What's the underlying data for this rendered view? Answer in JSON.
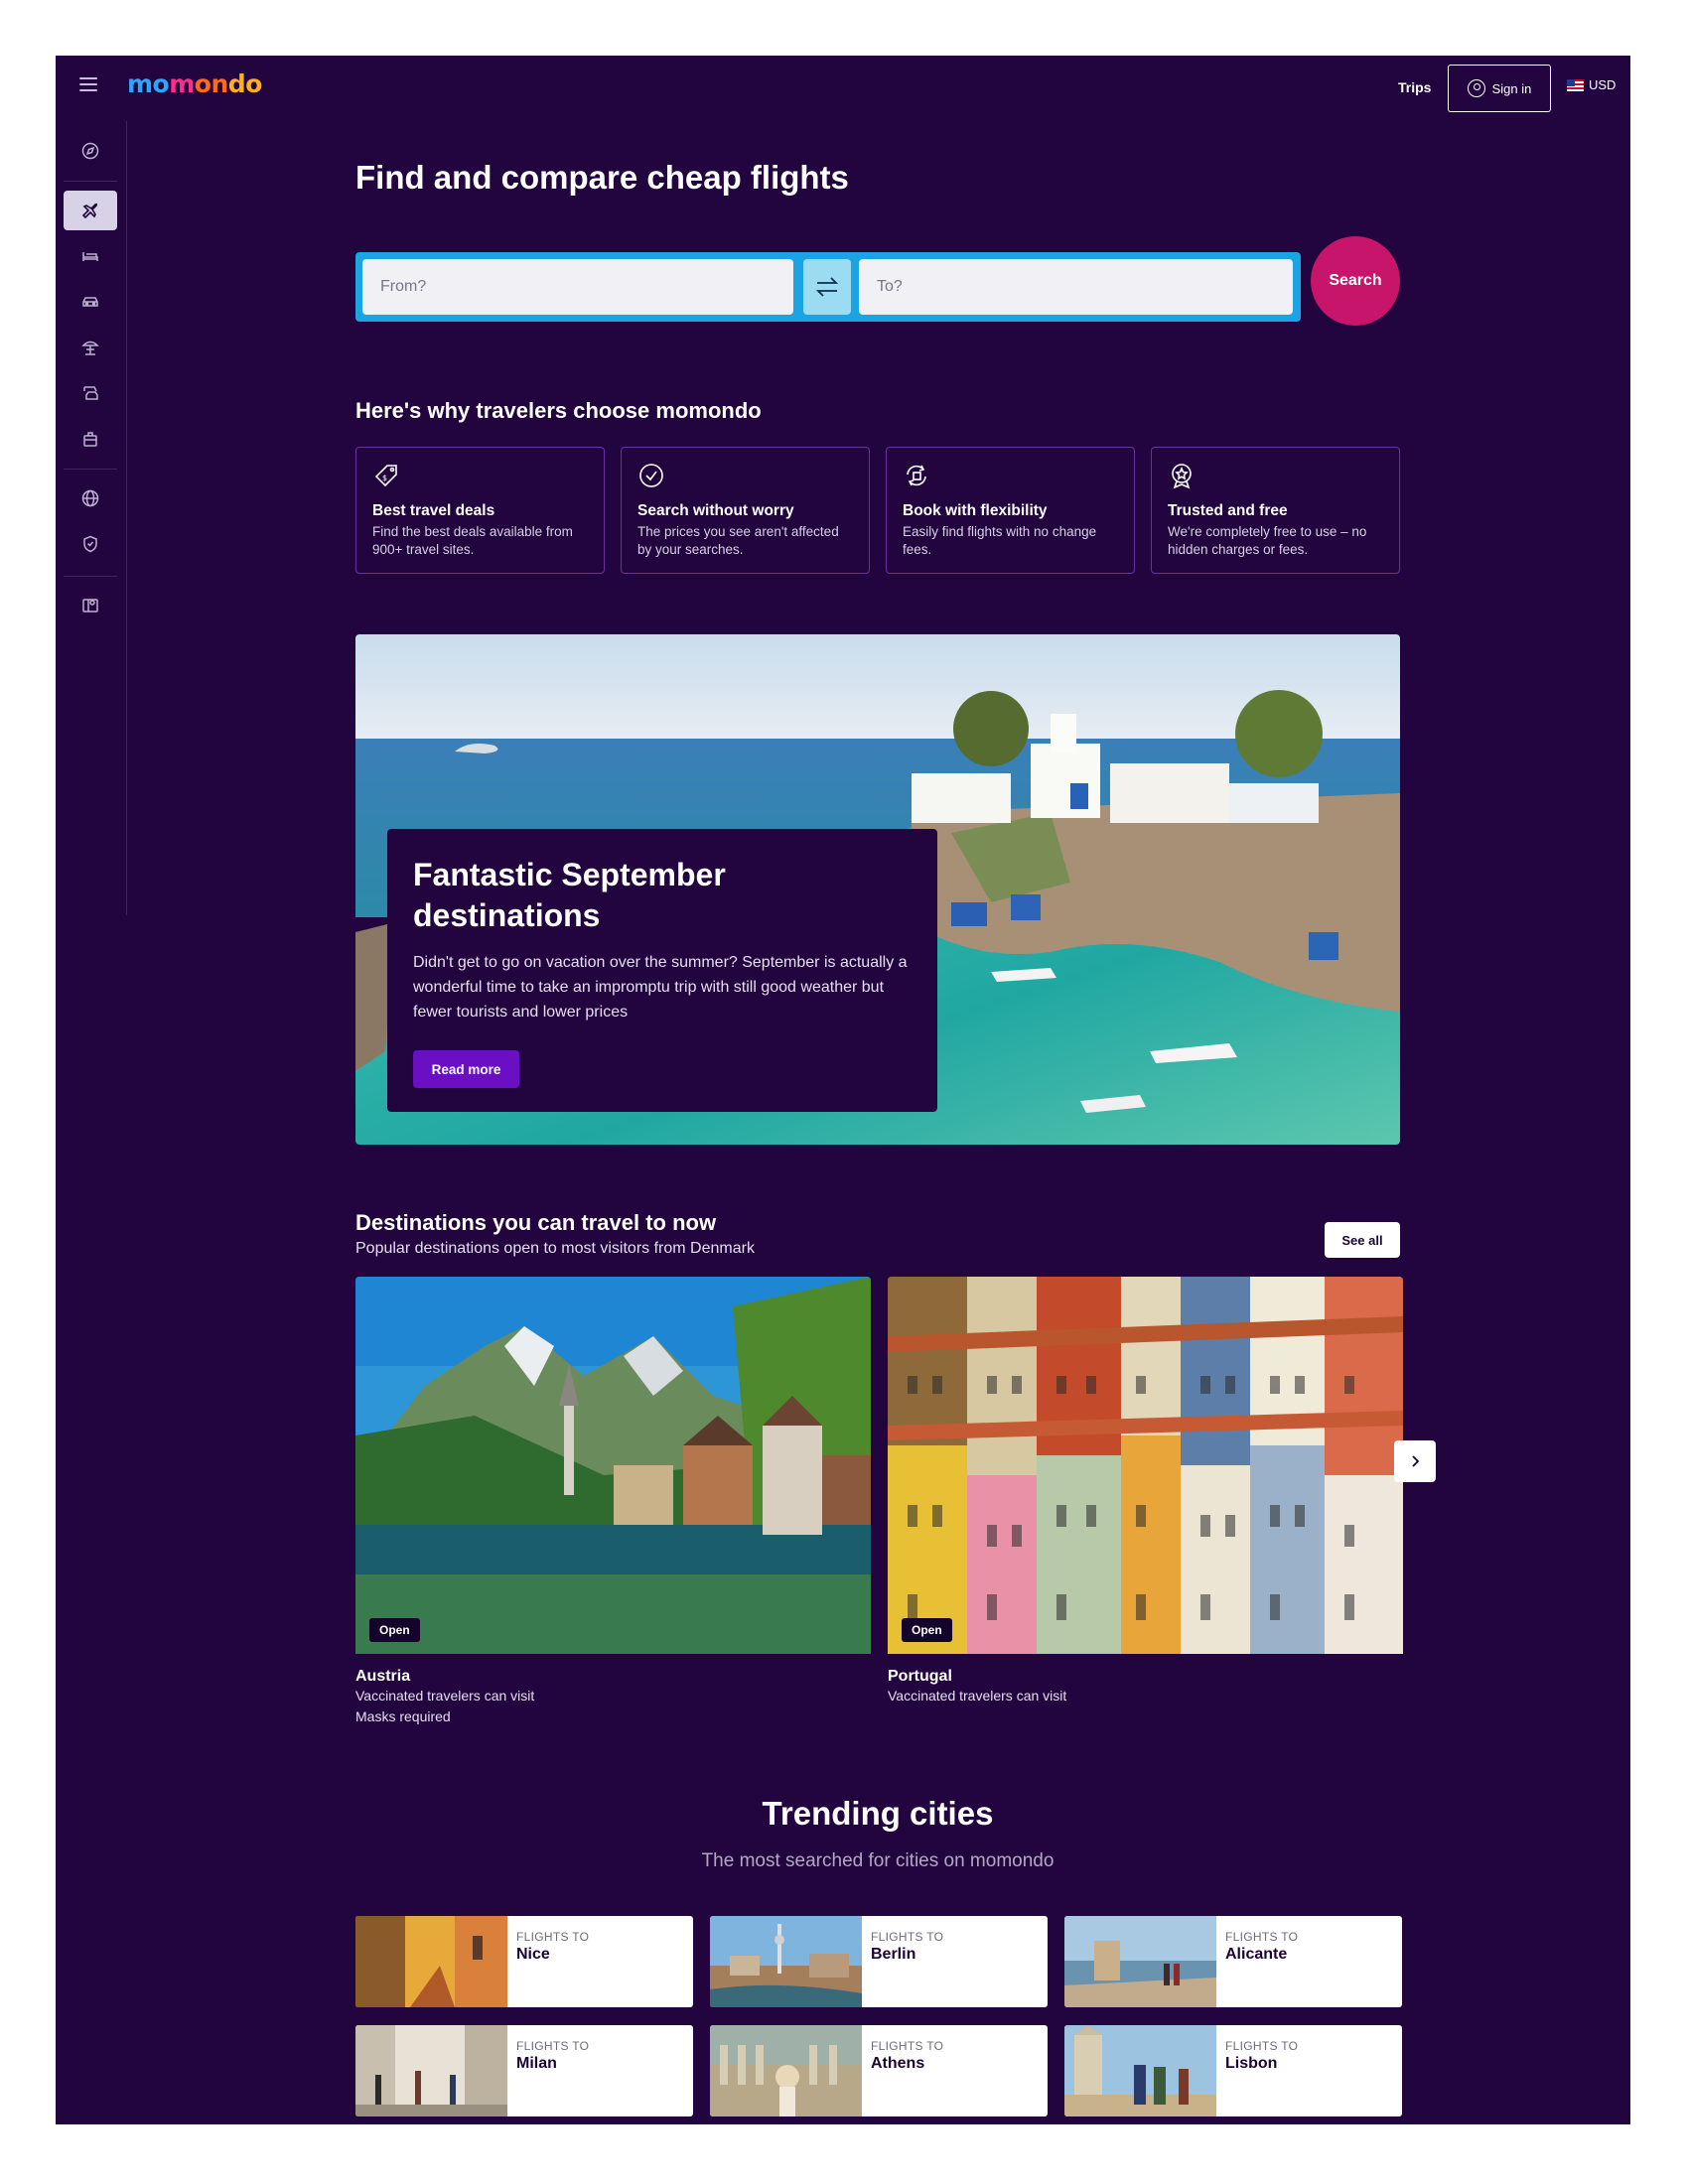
{
  "header": {
    "logo": "momondo",
    "trips": "Trips",
    "sign_in": "Sign in",
    "currency": "USD",
    "colors": {
      "background": "#22053e",
      "brand_blue": "#2aa6ff",
      "brand_pink": "#ff2e8b",
      "brand_orange": "#ff6a1a",
      "brand_yellow": "#ffb01f"
    }
  },
  "sidebar": {
    "items": [
      {
        "icon": "explore-icon"
      },
      {
        "icon": "plane-icon",
        "active": true
      },
      {
        "icon": "bed-icon"
      },
      {
        "icon": "car-icon"
      },
      {
        "icon": "beach-umbrella-icon"
      },
      {
        "icon": "car-plane-icon"
      },
      {
        "icon": "suitcase-icon"
      },
      {
        "icon": "globe-icon"
      },
      {
        "icon": "shield-icon"
      },
      {
        "icon": "map-icon"
      }
    ]
  },
  "search": {
    "title": "Find and compare cheap flights",
    "from_placeholder": "From?",
    "to_placeholder": "To?",
    "button": "Search",
    "colors": {
      "box": "#1ba4e4",
      "button": "#c6156a"
    }
  },
  "why": {
    "title": "Here's why travelers choose momondo",
    "cards": [
      {
        "icon": "tag-icon",
        "title": "Best travel deals",
        "desc": "Find the best deals available from 900+ travel sites."
      },
      {
        "icon": "check-circle-icon",
        "title": "Search without worry",
        "desc": "The prices you see aren't affected by your searches."
      },
      {
        "icon": "refresh-calendar-icon",
        "title": "Book with flexibility",
        "desc": "Easily find flights with no change fees."
      },
      {
        "icon": "badge-star-icon",
        "title": "Trusted and free",
        "desc": "We're completely free to use – no hidden charges or fees."
      }
    ]
  },
  "hero": {
    "title": "Fantastic September destinations",
    "desc": "Didn't get to go on vacation over the summer? September is actually a wonderful time to take an impromptu trip with still good weather but fewer tourists and lower prices",
    "button": "Read more"
  },
  "destinations": {
    "title": "Destinations you can travel to now",
    "subtitle": "Popular destinations open to most visitors from Denmark",
    "see_all": "See all",
    "items": [
      {
        "badge": "Open",
        "name": "Austria",
        "line1": "Vaccinated travelers can visit",
        "line2": "Masks required"
      },
      {
        "badge": "Open",
        "name": "Portugal",
        "line1": "Vaccinated travelers can visit",
        "line2": ""
      }
    ]
  },
  "trending": {
    "title": "Trending cities",
    "subtitle": "The most searched for cities on momondo",
    "label": "FLIGHTS TO",
    "cities": [
      {
        "name": "Nice"
      },
      {
        "name": "Berlin"
      },
      {
        "name": "Alicante"
      },
      {
        "name": "Milan"
      },
      {
        "name": "Athens"
      },
      {
        "name": "Lisbon"
      }
    ]
  }
}
